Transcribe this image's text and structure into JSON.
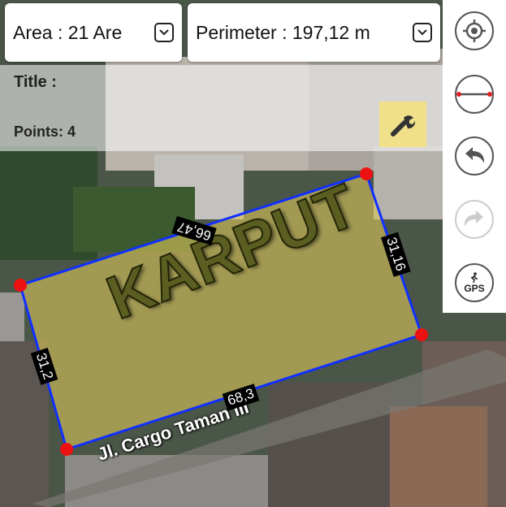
{
  "area": {
    "label": "Area : 21 Are"
  },
  "perimeter": {
    "label": "Perimeter : 197,12 m"
  },
  "info": {
    "title_label": "Title :",
    "points_label": "Points: 4"
  },
  "map": {
    "plot_name": "KARPUT",
    "street_name": "Jl. Cargo Taman III",
    "edges": {
      "top": "66,47",
      "right": "31,16",
      "bottom": "68,3",
      "left": "31,2"
    },
    "colors": {
      "polygon_fill": "#d8c35a",
      "polygon_stroke": "#1030ff",
      "vertex": "#ee1111"
    }
  },
  "toolbar": {
    "buttons": [
      {
        "name": "locate",
        "icon": "crosshair-icon",
        "enabled": true
      },
      {
        "name": "measure-line",
        "icon": "line-segment-icon",
        "enabled": true
      },
      {
        "name": "undo",
        "icon": "undo-icon",
        "enabled": true
      },
      {
        "name": "redo",
        "icon": "redo-icon",
        "enabled": false
      },
      {
        "name": "gps",
        "icon": "gps-walk-icon",
        "label": "GPS",
        "enabled": true
      }
    ]
  }
}
